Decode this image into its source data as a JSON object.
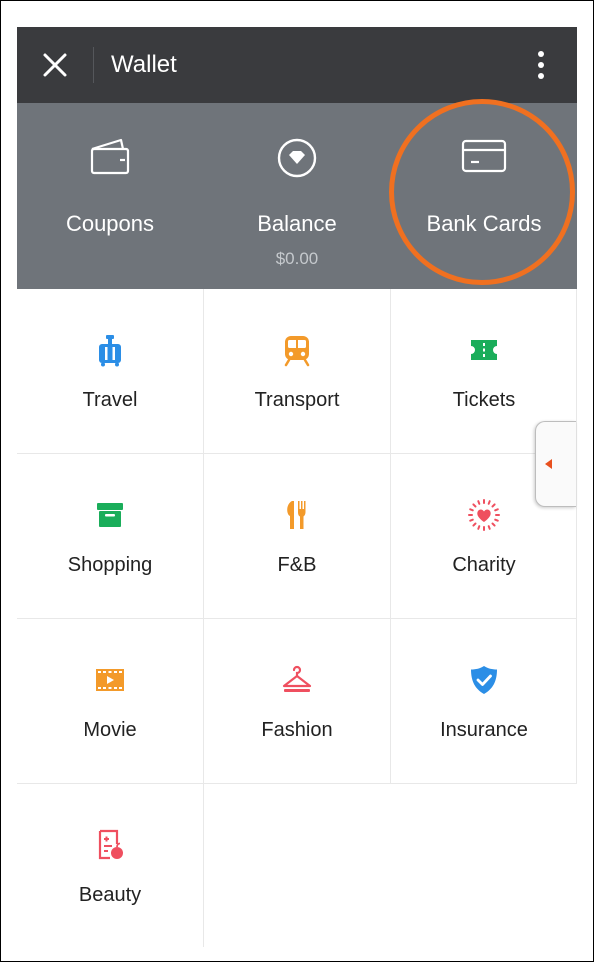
{
  "header": {
    "title": "Wallet",
    "close_icon": "close-icon",
    "more_icon": "more-vertical-icon"
  },
  "wallet_summary": {
    "items": [
      {
        "label": "Coupons",
        "icon": "wallet-icon"
      },
      {
        "label": "Balance",
        "sublabel": "$0.00",
        "icon": "balance-icon"
      },
      {
        "label": "Bank Cards",
        "icon": "card-icon",
        "highlighted": true
      }
    ],
    "highlight_color": "#f07020"
  },
  "services": [
    {
      "label": "Travel",
      "icon": "luggage-icon",
      "color": "#2b8ee6"
    },
    {
      "label": "Transport",
      "icon": "train-icon",
      "color": "#f39a2a"
    },
    {
      "label": "Tickets",
      "icon": "ticket-icon",
      "color": "#1aad5a"
    },
    {
      "label": "Shopping",
      "icon": "box-icon",
      "color": "#1aad5a"
    },
    {
      "label": "F&B",
      "icon": "fork-knife-icon",
      "color": "#f39a2a"
    },
    {
      "label": "Charity",
      "icon": "heart-icon",
      "color": "#ef4f5f"
    },
    {
      "label": "Movie",
      "icon": "film-icon",
      "color": "#f39a2a"
    },
    {
      "label": "Fashion",
      "icon": "hanger-icon",
      "color": "#ef4f5f"
    },
    {
      "label": "Insurance",
      "icon": "shield-check-icon",
      "color": "#2b8ee6"
    },
    {
      "label": "Beauty",
      "icon": "beauty-icon",
      "color": "#ef4f5f"
    }
  ]
}
